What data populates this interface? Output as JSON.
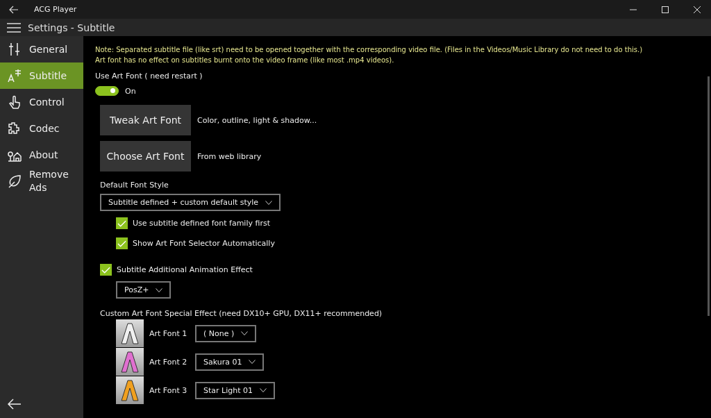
{
  "window": {
    "title": "ACG Player"
  },
  "header": {
    "title": "Settings - Subtitle"
  },
  "sidebar": {
    "items": [
      {
        "label": "General",
        "selected": false
      },
      {
        "label": "Subtitle",
        "selected": true
      },
      {
        "label": "Control",
        "selected": false
      },
      {
        "label": "Codec",
        "selected": false
      },
      {
        "label": "About",
        "selected": false
      },
      {
        "label": "Remove Ads",
        "selected": false
      }
    ]
  },
  "note": [
    "Note: Separated subtitle file (like srt) need to be opened together with the corresponding video file. (Files in the Videos/Music Library do not need to do this.)",
    "Art font has no effect on subtitles burnt onto the video frame (like most .mp4 videos)."
  ],
  "use_art_font": {
    "label": "Use Art Font  ( need restart )",
    "on": true,
    "state_text": "On"
  },
  "art_buttons": [
    {
      "label": "Tweak Art Font",
      "description": "Color, outline, light & shadow..."
    },
    {
      "label": "Choose Art Font",
      "description": "From web library"
    }
  ],
  "default_font_style": {
    "label": "Default Font Style",
    "value": "Subtitle defined + custom default style"
  },
  "style_options": [
    {
      "label": "Use subtitle defined font family first",
      "checked": true
    },
    {
      "label": "Show Art Font Selector Automatically",
      "checked": true
    }
  ],
  "animation": {
    "label": "Subtitle Additional Animation Effect",
    "checked": true,
    "value": "PosZ+"
  },
  "special_effect": {
    "label": "Custom Art Font Special Effect  (need DX10+ GPU, DX11+ recommended)",
    "items": [
      {
        "label": "Art Font 1",
        "value": "( None )",
        "color": "#f0f0f0"
      },
      {
        "label": "Art Font 2",
        "value": "Sakura 01",
        "color": "#e070d0"
      },
      {
        "label": "Art Font 3",
        "value": "Star Light 01",
        "color": "#f0a020"
      }
    ]
  }
}
